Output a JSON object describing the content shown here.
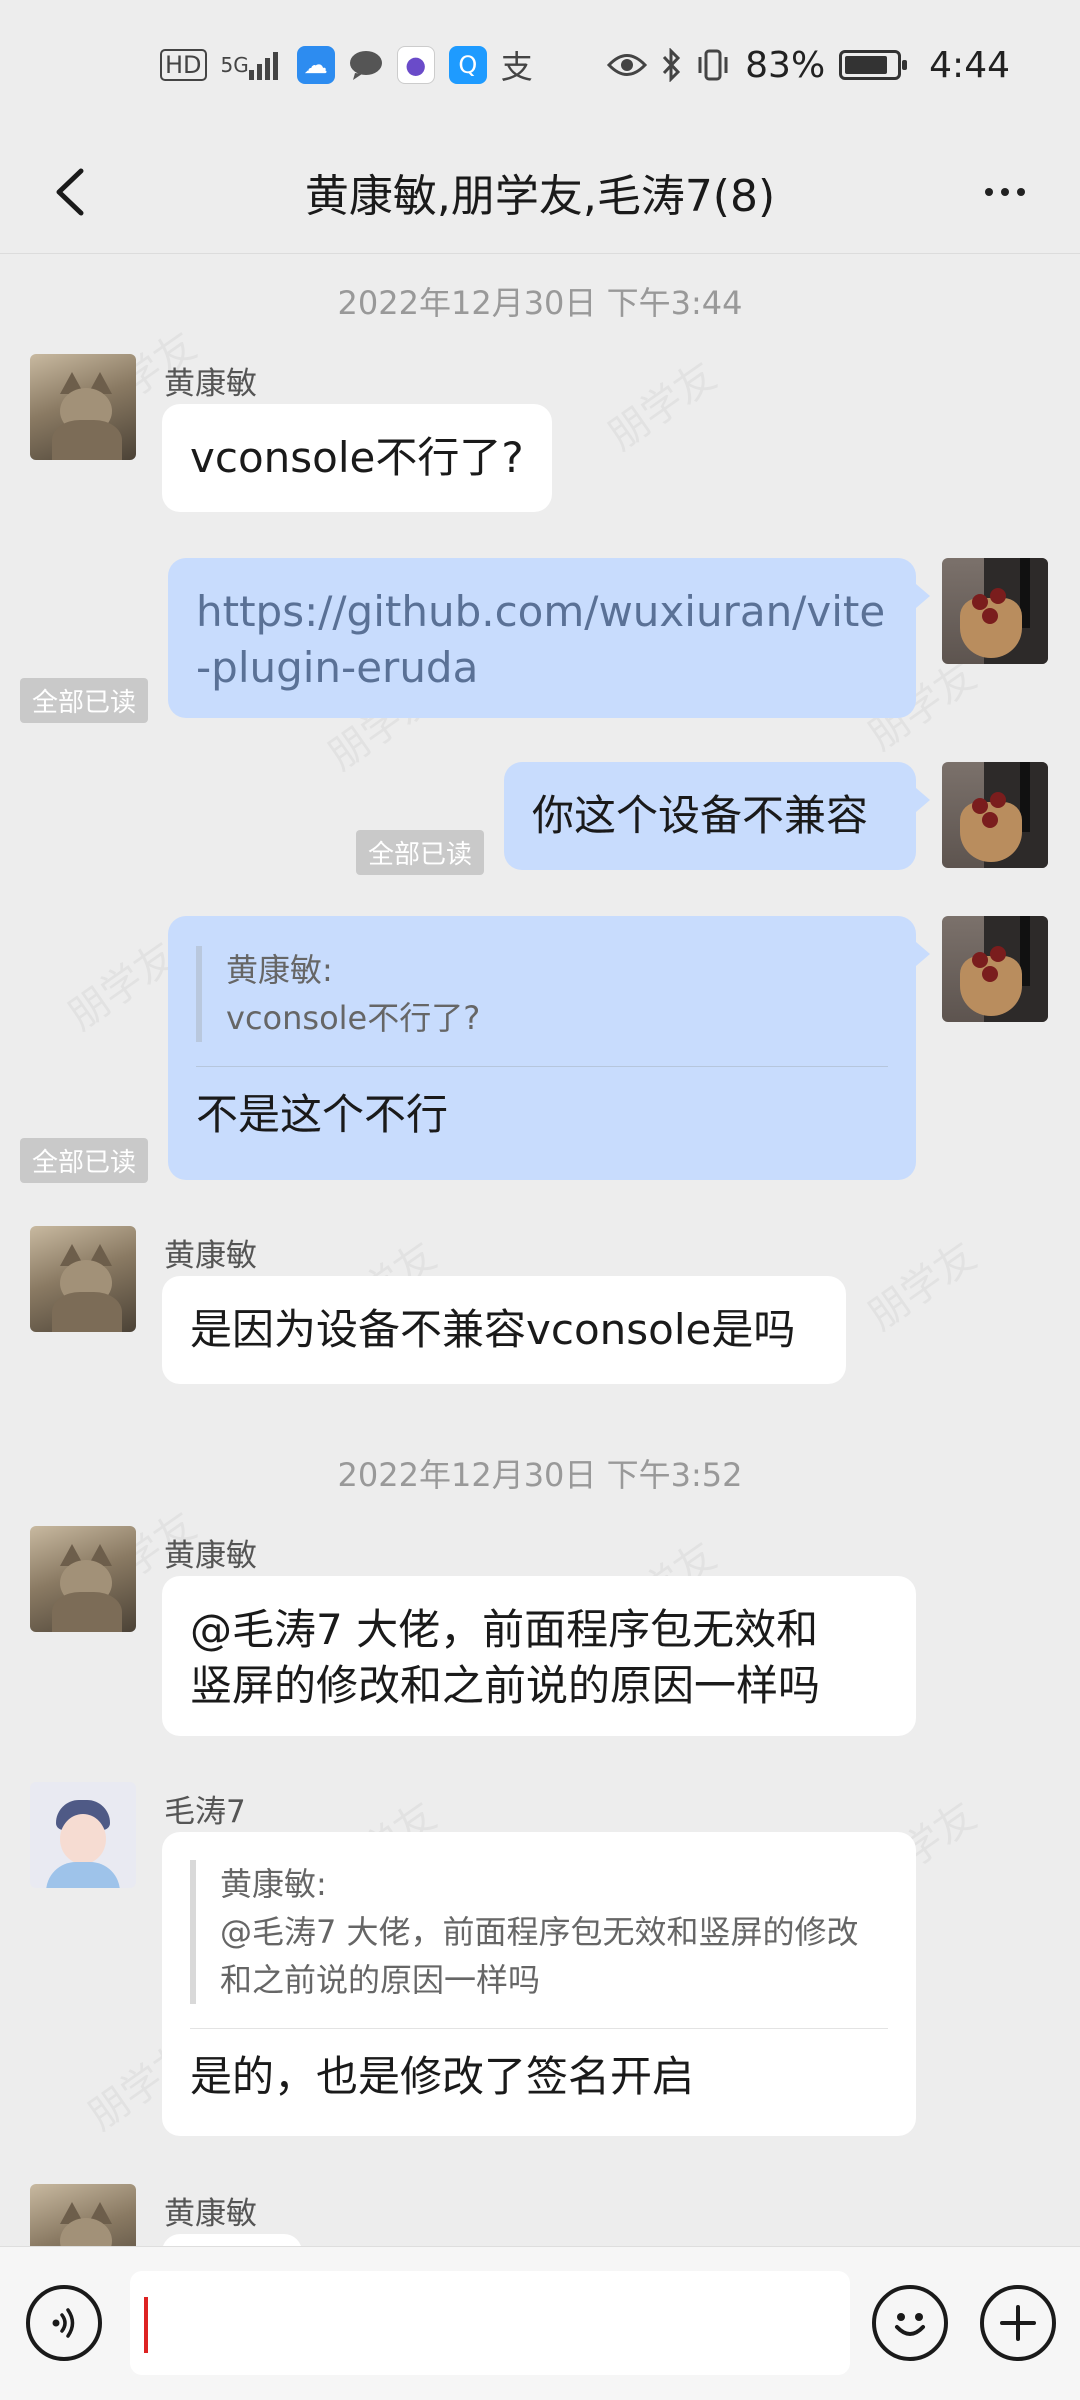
{
  "status_bar": {
    "network": "HD",
    "signal": "5G",
    "battery": "83%",
    "battery_level": 0.83,
    "time": "4:44"
  },
  "header": {
    "title": "黄康敏,朋学友,毛涛7(8)"
  },
  "watermark": "朋学友",
  "messages": [
    {
      "type": "timestamp",
      "text": "2022年12月30日 下午3:44"
    },
    {
      "type": "in",
      "sender": "黄康敏",
      "avatar": "cat-avatar",
      "text": "vconsole不行了?"
    },
    {
      "type": "out",
      "avatar": "suit-bouquet-avatar",
      "text": "https://github.com/wuxiuran/vite-plugin-eruda",
      "text_line1": "https://github.com/wuxiuran/vite",
      "text_line2": "-plugin-eruda",
      "read": "全部已读"
    },
    {
      "type": "out",
      "avatar": "suit-bouquet-avatar",
      "text": "你这个设备不兼容",
      "read": "全部已读"
    },
    {
      "type": "out",
      "avatar": "suit-bouquet-avatar",
      "quote_author": "黄康敏:",
      "quote_text": "vconsole不行了?",
      "text": "不是这个不行",
      "read": "全部已读"
    },
    {
      "type": "in",
      "sender": "黄康敏",
      "avatar": "cat-avatar",
      "text": "是因为设备不兼容vconsole是吗"
    },
    {
      "type": "timestamp",
      "text": "2022年12月30日 下午3:52"
    },
    {
      "type": "in",
      "sender": "黄康敏",
      "avatar": "cat-avatar",
      "text_line1": "@毛涛7 大佬，前面程序包无效和",
      "text_line2": "竖屏的修改和之前说的原因一样吗"
    },
    {
      "type": "in",
      "sender": "毛涛7",
      "avatar": "user-avatar",
      "quote_author": "黄康敏:",
      "quote_line1": "@毛涛7 大佬，前面程序包无效和竖屏的修改",
      "quote_line2": "和之前说的原因一样吗",
      "text": "是的，也是修改了签名开启"
    },
    {
      "type": "in",
      "sender": "黄康敏",
      "avatar": "cat-avatar",
      "text": ""
    }
  ],
  "input": {
    "value": "",
    "placeholder": ""
  },
  "icons": {
    "back": "back-arrow-icon",
    "more": "more-icon",
    "voice": "voice-icon",
    "emoji": "emoji-icon",
    "plus": "plus-icon"
  },
  "colors": {
    "background": "#ededed",
    "bubble_out": "#c8dcfd",
    "bubble_in": "#ffffff",
    "read_badge": "#c9c9c9",
    "caret": "#dd2222"
  }
}
